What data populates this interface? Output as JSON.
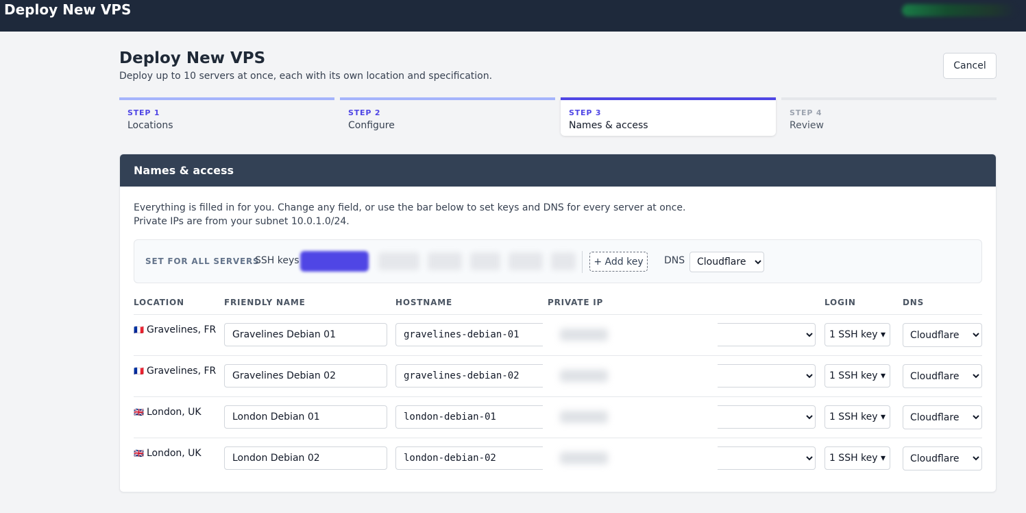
{
  "app": {
    "title": "Deploy New VPS"
  },
  "page": {
    "title": "Deploy New VPS",
    "subtitle": "Deploy up to 10 servers at once, each with its own location and specification.",
    "cancel_label": "Cancel"
  },
  "steps": [
    {
      "num": "STEP 1",
      "label": "Locations",
      "state": "done"
    },
    {
      "num": "STEP 2",
      "label": "Configure",
      "state": "done"
    },
    {
      "num": "STEP 3",
      "label": "Names & access",
      "state": "active"
    },
    {
      "num": "STEP 4",
      "label": "Review",
      "state": "pending"
    }
  ],
  "card": {
    "title": "Names & access",
    "intro_line1": "Everything is filled in for you. Change any field, or use the bar below to set keys and DNS for every server at once.",
    "intro_line2": "Private IPs are from your subnet 10.0.1.0/24."
  },
  "set_all": {
    "label": "SET FOR ALL SERVERS",
    "ssh_label": "SSH keys",
    "add_key_label": "+ Add key",
    "dns_label": "DNS",
    "dns_value": "Cloudflare"
  },
  "table": {
    "headers": {
      "location": "LOCATION",
      "friendly_name": "FRIENDLY NAME",
      "hostname": "HOSTNAME",
      "private_ip": "PRIVATE IP",
      "login": "LOGIN",
      "dns": "DNS"
    },
    "rows": [
      {
        "flag": "🇫🇷",
        "location": "Gravelines, FR",
        "name": "Gravelines Debian 01",
        "hostname": "gravelines-debian-01",
        "login": "1 SSH key ▾",
        "dns": "Cloudflare"
      },
      {
        "flag": "🇫🇷",
        "location": "Gravelines, FR",
        "name": "Gravelines Debian 02",
        "hostname": "gravelines-debian-02",
        "login": "1 SSH key ▾",
        "dns": "Cloudflare"
      },
      {
        "flag": "🇬🇧",
        "location": "London, UK",
        "name": "London Debian 01",
        "hostname": "london-debian-01",
        "login": "1 SSH key ▾",
        "dns": "Cloudflare"
      },
      {
        "flag": "🇬🇧",
        "location": "London, UK",
        "name": "London Debian 02",
        "hostname": "london-debian-02",
        "login": "1 SSH key ▾",
        "dns": "Cloudflare"
      }
    ]
  }
}
